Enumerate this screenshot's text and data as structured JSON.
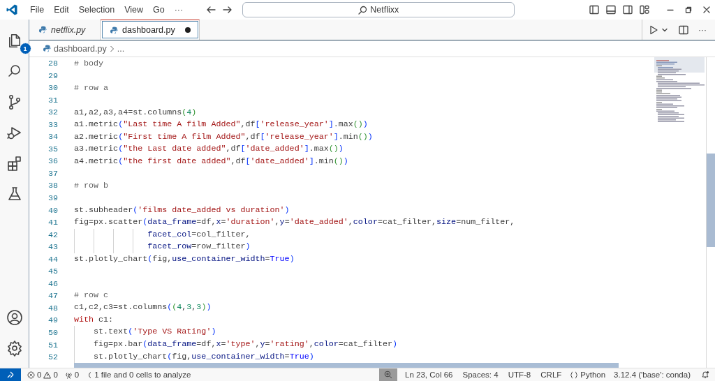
{
  "title_bar": {
    "menus": [
      "File",
      "Edit",
      "Selection",
      "View",
      "Go",
      "···"
    ],
    "command_center": "Netflixx"
  },
  "activity_bar": {
    "explorer_badge": "1"
  },
  "tabs": [
    {
      "label": "netflix.py",
      "selected": false,
      "preview": true,
      "modified": false
    },
    {
      "label": "dashboard.py",
      "selected": true,
      "preview": false,
      "modified": true
    }
  ],
  "editor_more": "···",
  "breadcrumb": [
    "dashboard.py",
    "..."
  ],
  "lines": [
    {
      "number": "28",
      "tokens": [
        {
          "text": "# body",
          "kind": "comment"
        }
      ]
    },
    {
      "number": "29"
    },
    {
      "number": "30",
      "tokens": [
        {
          "text": "# row a",
          "kind": "comment"
        }
      ]
    },
    {
      "number": "31"
    },
    {
      "number": "32",
      "tokens": [
        {
          "text": "a1,a2,a3,a4=st.columns",
          "kind": "plain"
        },
        {
          "text": "(",
          "kind": "bracket2"
        },
        {
          "text": "4",
          "kind": "number"
        },
        {
          "text": ")",
          "kind": "bracket2"
        }
      ]
    },
    {
      "number": "33",
      "tokens": [
        {
          "text": "a1.metric",
          "kind": "plain"
        },
        {
          "text": "(",
          "kind": "bracket"
        },
        {
          "text": "\"Last time A film Added\"",
          "kind": "string"
        },
        {
          "text": ",df",
          "kind": "plain"
        },
        {
          "text": "[",
          "kind": "bracket"
        },
        {
          "text": "'release_year'",
          "kind": "string"
        },
        {
          "text": "]",
          "kind": "bracket"
        },
        {
          "text": ".max",
          "kind": "plain"
        },
        {
          "text": "()",
          "kind": "bracket2"
        },
        {
          "text": ")",
          "kind": "bracket"
        }
      ]
    },
    {
      "number": "34",
      "tokens": [
        {
          "text": "a2.metric",
          "kind": "plain"
        },
        {
          "text": "(",
          "kind": "bracket"
        },
        {
          "text": "\"First time A film Added\"",
          "kind": "string"
        },
        {
          "text": ",df",
          "kind": "plain"
        },
        {
          "text": "[",
          "kind": "bracket"
        },
        {
          "text": "'release_year'",
          "kind": "string"
        },
        {
          "text": "]",
          "kind": "bracket"
        },
        {
          "text": ".min",
          "kind": "plain"
        },
        {
          "text": "()",
          "kind": "bracket2"
        },
        {
          "text": ")",
          "kind": "bracket"
        }
      ]
    },
    {
      "number": "35",
      "tokens": [
        {
          "text": "a3.metric",
          "kind": "plain"
        },
        {
          "text": "(",
          "kind": "bracket"
        },
        {
          "text": "\"the Last date added\"",
          "kind": "string"
        },
        {
          "text": ",df",
          "kind": "plain"
        },
        {
          "text": "[",
          "kind": "bracket"
        },
        {
          "text": "'date_added'",
          "kind": "string"
        },
        {
          "text": "]",
          "kind": "bracket"
        },
        {
          "text": ".max",
          "kind": "plain"
        },
        {
          "text": "()",
          "kind": "bracket2"
        },
        {
          "text": ")",
          "kind": "bracket"
        }
      ]
    },
    {
      "number": "36",
      "tokens": [
        {
          "text": "a4.metric",
          "kind": "plain"
        },
        {
          "text": "(",
          "kind": "bracket"
        },
        {
          "text": "\"the first date added\"",
          "kind": "string"
        },
        {
          "text": ",df",
          "kind": "plain"
        },
        {
          "text": "[",
          "kind": "bracket"
        },
        {
          "text": "'date_added'",
          "kind": "string"
        },
        {
          "text": "]",
          "kind": "bracket"
        },
        {
          "text": ".min",
          "kind": "plain"
        },
        {
          "text": "()",
          "kind": "bracket2"
        },
        {
          "text": ")",
          "kind": "bracket"
        }
      ]
    },
    {
      "number": "37"
    },
    {
      "number": "38",
      "tokens": [
        {
          "text": "# row b",
          "kind": "comment"
        }
      ]
    },
    {
      "number": "39"
    },
    {
      "number": "40",
      "tokens": [
        {
          "text": "st.subheader",
          "kind": "plain"
        },
        {
          "text": "(",
          "kind": "bracket"
        },
        {
          "text": "'films date_added vs duration'",
          "kind": "string"
        },
        {
          "text": ")",
          "kind": "bracket"
        }
      ]
    },
    {
      "number": "41",
      "tokens": [
        {
          "text": "fig=px.scatter",
          "kind": "plain"
        },
        {
          "text": "(",
          "kind": "bracket"
        },
        {
          "text": "data_frame",
          "kind": "param"
        },
        {
          "text": "=df,",
          "kind": "plain"
        },
        {
          "text": "x",
          "kind": "param"
        },
        {
          "text": "=",
          "kind": "plain"
        },
        {
          "text": "'duration'",
          "kind": "string"
        },
        {
          "text": ",",
          "kind": "plain"
        },
        {
          "text": "y",
          "kind": "param"
        },
        {
          "text": "=",
          "kind": "plain"
        },
        {
          "text": "'date_added'",
          "kind": "string"
        },
        {
          "text": ",",
          "kind": "plain"
        },
        {
          "text": "color",
          "kind": "param"
        },
        {
          "text": "=cat_filter,",
          "kind": "plain"
        },
        {
          "text": "size",
          "kind": "param"
        },
        {
          "text": "=num_filter,",
          "kind": "plain"
        }
      ]
    },
    {
      "number": "42",
      "tokens": [
        {
          "text": "               facet_col",
          "kind": "param"
        },
        {
          "text": "=col_filter,",
          "kind": "plain"
        }
      ]
    },
    {
      "number": "43",
      "tokens": [
        {
          "text": "               facet_row",
          "kind": "param"
        },
        {
          "text": "=row_filter",
          "kind": "plain"
        },
        {
          "text": ")",
          "kind": "bracket"
        }
      ]
    },
    {
      "number": "44",
      "tokens": [
        {
          "text": "st.plotly_chart",
          "kind": "plain"
        },
        {
          "text": "(",
          "kind": "bracket"
        },
        {
          "text": "fig,",
          "kind": "plain"
        },
        {
          "text": "use_container_width",
          "kind": "param"
        },
        {
          "text": "=",
          "kind": "plain"
        },
        {
          "text": "True",
          "kind": "constant"
        },
        {
          "text": ")",
          "kind": "bracket"
        }
      ]
    },
    {
      "number": "45"
    },
    {
      "number": "46"
    },
    {
      "number": "47",
      "tokens": [
        {
          "text": "# row c",
          "kind": "comment"
        }
      ]
    },
    {
      "number": "48",
      "tokens": [
        {
          "text": "c1,c2,c3=st.columns",
          "kind": "plain"
        },
        {
          "text": "(",
          "kind": "bracket"
        },
        {
          "text": "(",
          "kind": "bracket2"
        },
        {
          "text": "4",
          "kind": "number"
        },
        {
          "text": ",",
          "kind": "plain"
        },
        {
          "text": "3",
          "kind": "number"
        },
        {
          "text": ",",
          "kind": "plain"
        },
        {
          "text": "3",
          "kind": "number"
        },
        {
          "text": ")",
          "kind": "bracket2"
        },
        {
          "text": ")",
          "kind": "bracket"
        }
      ]
    },
    {
      "number": "49",
      "tokens": [
        {
          "text": "with",
          "kind": "keyword"
        },
        {
          "text": " c1:",
          "kind": "plain"
        }
      ]
    },
    {
      "number": "50",
      "tokens": [
        {
          "text": "    st.text",
          "kind": "plain"
        },
        {
          "text": "(",
          "kind": "bracket"
        },
        {
          "text": "'Type VS Rating'",
          "kind": "string"
        },
        {
          "text": ")",
          "kind": "bracket"
        }
      ]
    },
    {
      "number": "51",
      "tokens": [
        {
          "text": "    fig=px.bar",
          "kind": "plain"
        },
        {
          "text": "(",
          "kind": "bracket"
        },
        {
          "text": "data_frame",
          "kind": "param"
        },
        {
          "text": "=df,",
          "kind": "plain"
        },
        {
          "text": "x",
          "kind": "param"
        },
        {
          "text": "=",
          "kind": "plain"
        },
        {
          "text": "'type'",
          "kind": "string"
        },
        {
          "text": ",",
          "kind": "plain"
        },
        {
          "text": "y",
          "kind": "param"
        },
        {
          "text": "=",
          "kind": "plain"
        },
        {
          "text": "'rating'",
          "kind": "string"
        },
        {
          "text": ",",
          "kind": "plain"
        },
        {
          "text": "color",
          "kind": "param"
        },
        {
          "text": "=cat_filter",
          "kind": "plain"
        },
        {
          "text": ")",
          "kind": "bracket"
        }
      ]
    },
    {
      "number": "52",
      "tokens": [
        {
          "text": "    st.plotly_chart",
          "kind": "plain"
        },
        {
          "text": "(",
          "kind": "bracket"
        },
        {
          "text": "fig,",
          "kind": "plain"
        },
        {
          "text": "use_container_width",
          "kind": "param"
        },
        {
          "text": "=",
          "kind": "plain"
        },
        {
          "text": "True",
          "kind": "constant"
        },
        {
          "text": ")",
          "kind": "bracket"
        }
      ]
    }
  ],
  "status_bar": {
    "errors": "0",
    "warnings": "0",
    "ports": "0",
    "analysis": "1 file and 0 cells to analyze",
    "position": "Ln 23, Col 66",
    "indentation": "Spaces: 4",
    "encoding": "UTF-8",
    "eol": "CRLF",
    "language": "Python",
    "interpreter": "3.12.4 ('base': conda)"
  }
}
